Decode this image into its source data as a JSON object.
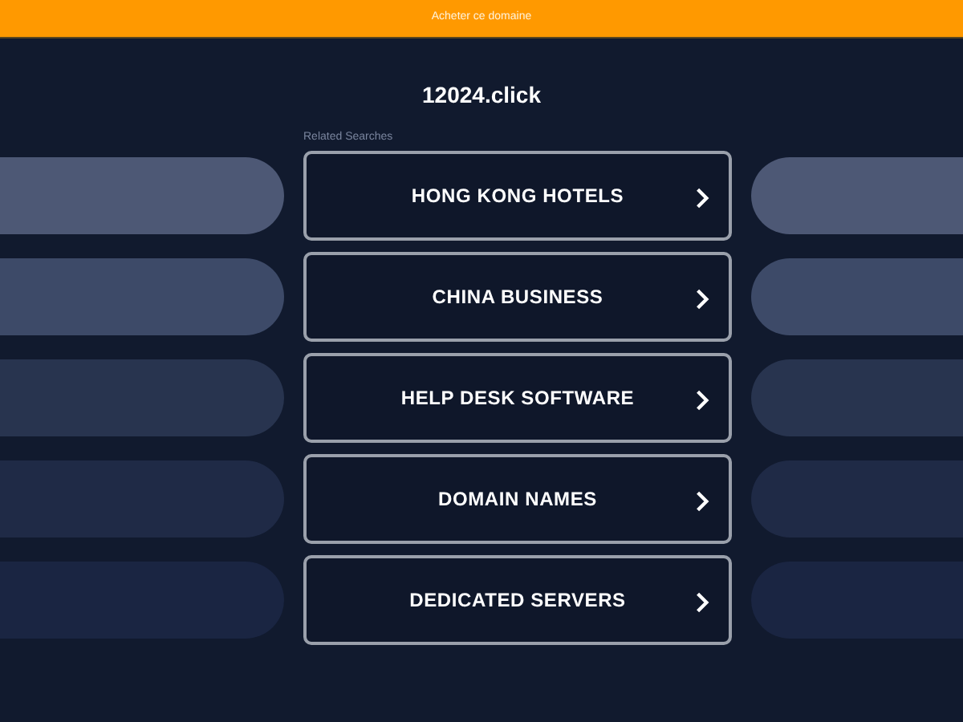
{
  "banner": {
    "text": "Acheter ce domaine"
  },
  "site_title": "12024.click",
  "related_label": "Related Searches",
  "links": [
    {
      "label": "HONG KONG HOTELS"
    },
    {
      "label": "CHINA BUSINESS"
    },
    {
      "label": "HELP DESK SOFTWARE"
    },
    {
      "label": "DOMAIN NAMES"
    },
    {
      "label": "DEDICATED SERVERS"
    }
  ]
}
